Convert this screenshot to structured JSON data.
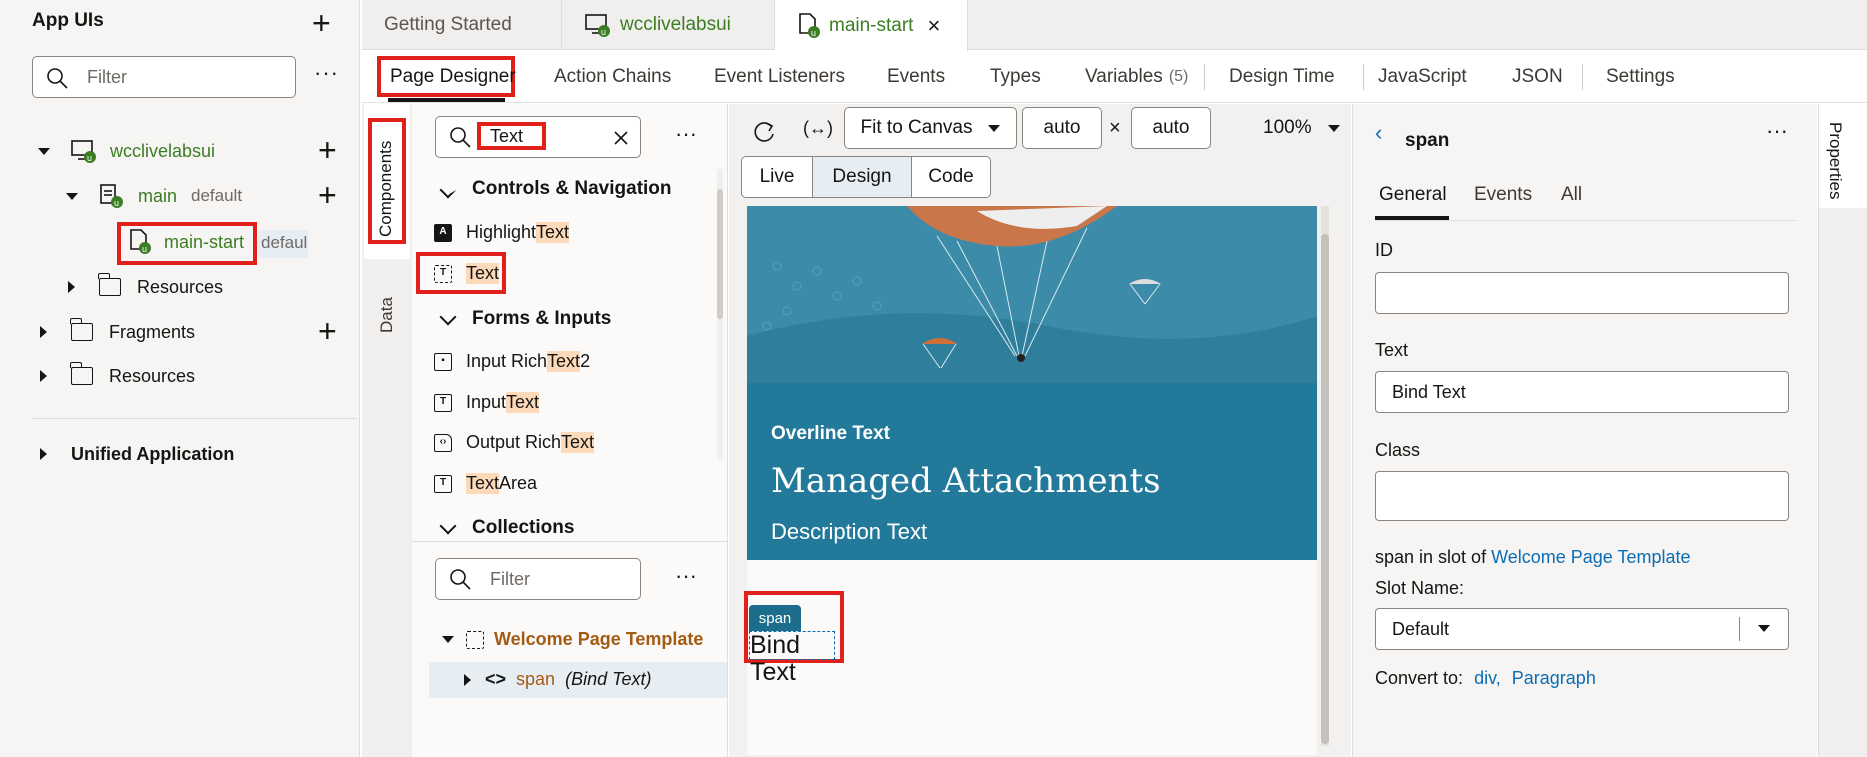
{
  "left": {
    "title": "App UIs",
    "filter_placeholder": "Filter",
    "tree": {
      "app": "wcclivelabsui",
      "main": "main",
      "main_badge": "default",
      "main_start": "main-start",
      "main_start_badge": "defaul",
      "resources_inner": "Resources",
      "fragments": "Fragments",
      "resources": "Resources",
      "unified": "Unified Application"
    }
  },
  "tabs": {
    "getting_started": "Getting Started",
    "app": "wcclivelabsui",
    "main_start": "main-start",
    "close": "×"
  },
  "designer_tabs": {
    "page_designer": "Page Designer",
    "action_chains": "Action Chains",
    "event_listeners": "Event Listeners",
    "events": "Events",
    "types": "Types",
    "variables": "Variables",
    "variables_count": "(5)",
    "design_time": "Design Time",
    "javascript": "JavaScript",
    "json": "JSON",
    "settings": "Settings"
  },
  "side_tabs": {
    "components": "Components",
    "data": "Data",
    "properties": "Properties"
  },
  "components": {
    "search_value": "Text",
    "sections": {
      "controls": "Controls & Navigation",
      "forms": "Forms & Inputs",
      "collections": "Collections"
    },
    "items": {
      "highlight_pre": "Highlight ",
      "highlight_hl": "Text",
      "text_hl": "Text",
      "input_rich_pre": "Input Rich ",
      "input_rich_hl": "Text",
      "input_rich_post": " 2",
      "input_pre": "Input ",
      "input_hl": "Text",
      "output_pre": "Output Rich ",
      "output_hl": "Text",
      "area_hl": "Text",
      "area_post": " Area"
    },
    "structure_filter": "Filter",
    "structure": {
      "template": "Welcome Page Template",
      "span": "span",
      "span_note": "(Bind Text)"
    }
  },
  "toolbar": {
    "fit": "Fit to Canvas",
    "width": "auto",
    "times": "×",
    "height": "auto",
    "zoom": "100%",
    "live": "Live",
    "design": "Design",
    "code": "Code"
  },
  "canvas": {
    "overline": "Overline Text",
    "title": "Managed Attachments",
    "description": "Description Text",
    "span_badge": "span",
    "bind_text": "Bind Text"
  },
  "props": {
    "header": "span",
    "tabs": {
      "general": "General",
      "events": "Events",
      "all": "All"
    },
    "id_label": "ID",
    "id_value": "",
    "text_label": "Text",
    "text_value": "Bind Text",
    "class_label": "Class",
    "class_value": "",
    "slot_prefix": "span in slot of",
    "slot_link": "Welcome Page Template",
    "slot_name_label": "Slot Name:",
    "slot_name_value": "Default",
    "convert_label": "Convert to:",
    "convert_div": "div,",
    "convert_paragraph": "Paragraph"
  },
  "colors": {
    "accent_green": "#3b7d23",
    "banner": "#23799a",
    "highlight": "#e0201b",
    "link": "#0a6db5"
  }
}
